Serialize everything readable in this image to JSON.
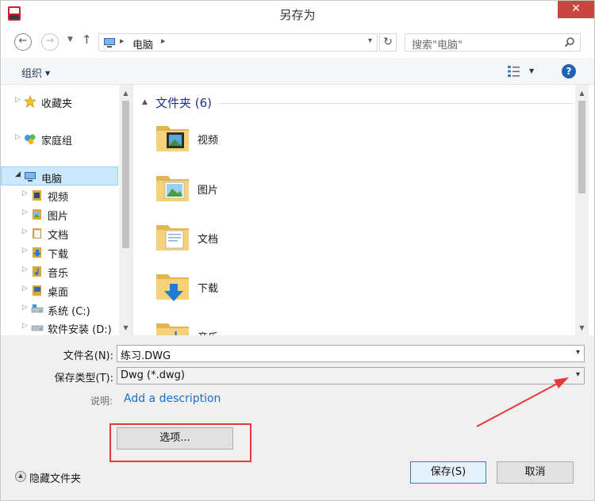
{
  "window": {
    "title": "另存为",
    "close_glyph": "✕",
    "app_icon": "sw-app-icon"
  },
  "nav": {
    "back_icon": "back-arrow-icon",
    "forward_icon": "forward-arrow-icon",
    "recent_icon": "chevron-down-icon",
    "up_icon": "up-arrow-icon",
    "address_path": "电脑",
    "refresh_icon": "refresh-icon",
    "search_placeholder": "搜索\"电脑\""
  },
  "toolbar": {
    "organize_label": "组织",
    "view_icon": "view-options-icon",
    "help_label": "?"
  },
  "sidebar": {
    "items": [
      {
        "label": "收藏夹",
        "icon": "favorites-star-icon"
      },
      {
        "label": "家庭组",
        "icon": "homegroup-icon"
      },
      {
        "label": "电脑",
        "icon": "computer-icon",
        "selected": true
      },
      {
        "label": "视频",
        "icon": "videos-library-icon"
      },
      {
        "label": "图片",
        "icon": "pictures-library-icon"
      },
      {
        "label": "文档",
        "icon": "documents-library-icon"
      },
      {
        "label": "下载",
        "icon": "downloads-icon"
      },
      {
        "label": "音乐",
        "icon": "music-library-icon"
      },
      {
        "label": "桌面",
        "icon": "desktop-icon"
      },
      {
        "label": "系统 (C:)",
        "icon": "system-drive-icon"
      },
      {
        "label": "软件安装 (D:)",
        "icon": "drive-icon"
      }
    ]
  },
  "content": {
    "group_title": "文件夹 (6)",
    "folders": [
      {
        "label": "视频",
        "icon": "videos-folder-icon"
      },
      {
        "label": "图片",
        "icon": "pictures-folder-icon"
      },
      {
        "label": "文档",
        "icon": "documents-folder-icon"
      },
      {
        "label": "下载",
        "icon": "downloads-folder-icon"
      },
      {
        "label": "音乐",
        "icon": "music-folder-icon"
      }
    ]
  },
  "form": {
    "filename_label": "文件名(N):",
    "filename_value": "练习.DWG",
    "filetype_label": "保存类型(T):",
    "filetype_value": "Dwg (*.dwg)",
    "description_label": "说明:",
    "description_link": "Add a description"
  },
  "buttons": {
    "options": "选项...",
    "save": "保存(S)",
    "cancel": "取消",
    "hide_folders": "隐藏文件夹"
  },
  "colors": {
    "annotation": "#e6393b",
    "selection": "#cce8ff",
    "link": "#1a6fc7",
    "close": "#c7463d"
  }
}
